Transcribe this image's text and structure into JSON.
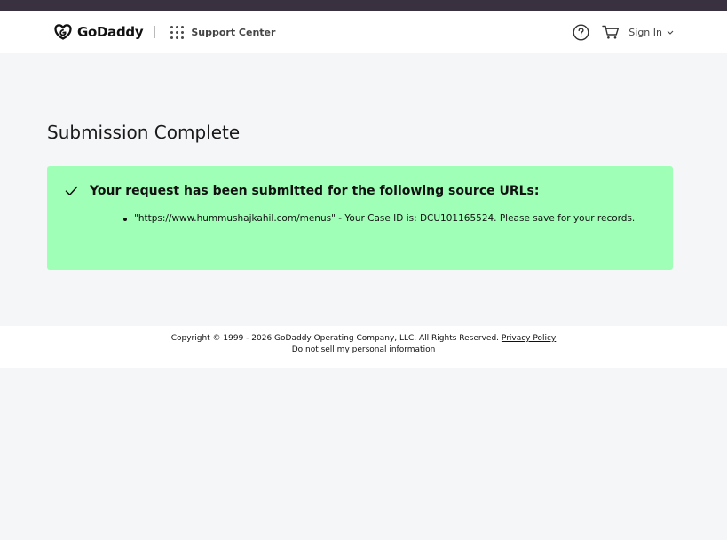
{
  "header": {
    "brand": "GoDaddy",
    "support_center": "Support Center",
    "sign_in": "Sign In",
    "icons": {
      "logo": "godaddy-logo",
      "apps": "apps-grid-icon",
      "help": "question-circle-icon",
      "cart": "cart-icon",
      "chevron": "chevron-down-icon"
    }
  },
  "main": {
    "title": "Submission Complete",
    "alert": {
      "heading": "Your request has been submitted for the following source URLs:",
      "items": [
        "\"https://www.hummushajkahil.com/menus\" - Your Case ID is: DCU101165524. Please save for your records."
      ],
      "background": "#9fffb6"
    }
  },
  "footer": {
    "copyright": "Copyright © 1999 - 2026 GoDaddy Operating Company, LLC. All Rights Reserved.",
    "privacy_policy": "Privacy Policy",
    "do_not_sell": "Do not sell my personal information"
  },
  "colors": {
    "topbar": "#3a3140",
    "page_background": "#f5f6f8",
    "success_background": "#9fffb6"
  }
}
